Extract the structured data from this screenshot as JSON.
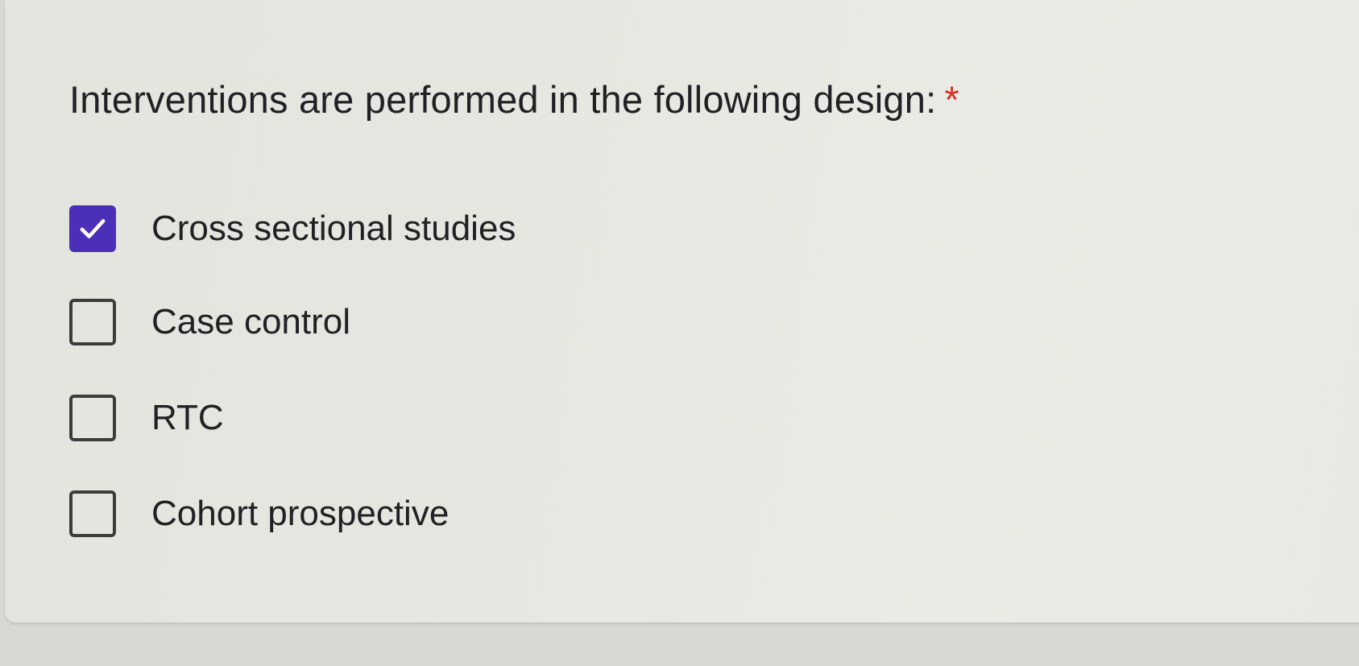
{
  "question": {
    "text": "Interventions are performed in the following design:",
    "required_marker": "*",
    "required_color": "#d93025"
  },
  "accent_color": "#4b2fb8",
  "options": [
    {
      "label": "Cross sectional studies",
      "checked": true
    },
    {
      "label": "Case control",
      "checked": false
    },
    {
      "label": "RTC",
      "checked": false
    },
    {
      "label": "Cohort prospective",
      "checked": false
    }
  ]
}
